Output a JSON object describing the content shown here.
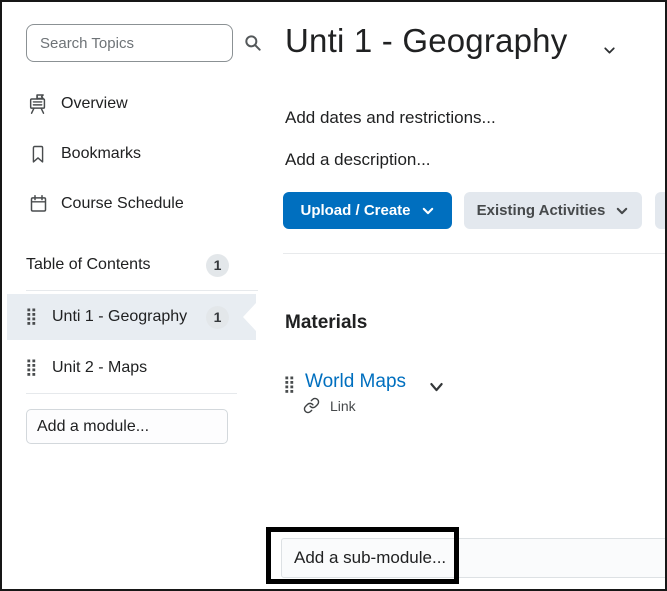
{
  "colors": {
    "primary_button": "#006fbf",
    "link": "#006fbf",
    "selected_module_bg": "#e8edf2",
    "secondary_button_bg": "#e3e8ee",
    "badge_bg": "#e3e7ea",
    "annotation_border": "#000000"
  },
  "sidebar": {
    "search": {
      "placeholder": "Search Topics",
      "icon": "search-icon"
    },
    "nav": [
      {
        "label": "Overview",
        "icon": "easel-icon"
      },
      {
        "label": "Bookmarks",
        "icon": "bookmark-icon"
      },
      {
        "label": "Course Schedule",
        "icon": "calendar-icon"
      }
    ],
    "toc": {
      "label": "Table of Contents",
      "badge": "1"
    },
    "modules": [
      {
        "label": "Unti 1 - Geography",
        "badge": "1",
        "selected": true,
        "icon": "drag-handle-icon"
      },
      {
        "label": "Unit 2 - Maps",
        "badge": "",
        "selected": false,
        "icon": "drag-handle-icon"
      }
    ],
    "add_module_placeholder": "Add a module..."
  },
  "main": {
    "title": "Unti 1 - Geography",
    "title_menu_icon": "chevron-down-icon",
    "add_dates": "Add dates and restrictions...",
    "add_description": "Add a description...",
    "buttons": {
      "upload_create": "Upload / Create",
      "existing_activities": "Existing Activities"
    },
    "materials": {
      "heading": "Materials",
      "items": [
        {
          "title": "World Maps",
          "type_label": "Link",
          "type_icon": "link-icon",
          "drag_icon": "drag-handle-icon",
          "menu_icon": "chevron-down-icon"
        }
      ]
    },
    "add_submodule_placeholder": "Add a sub-module..."
  }
}
